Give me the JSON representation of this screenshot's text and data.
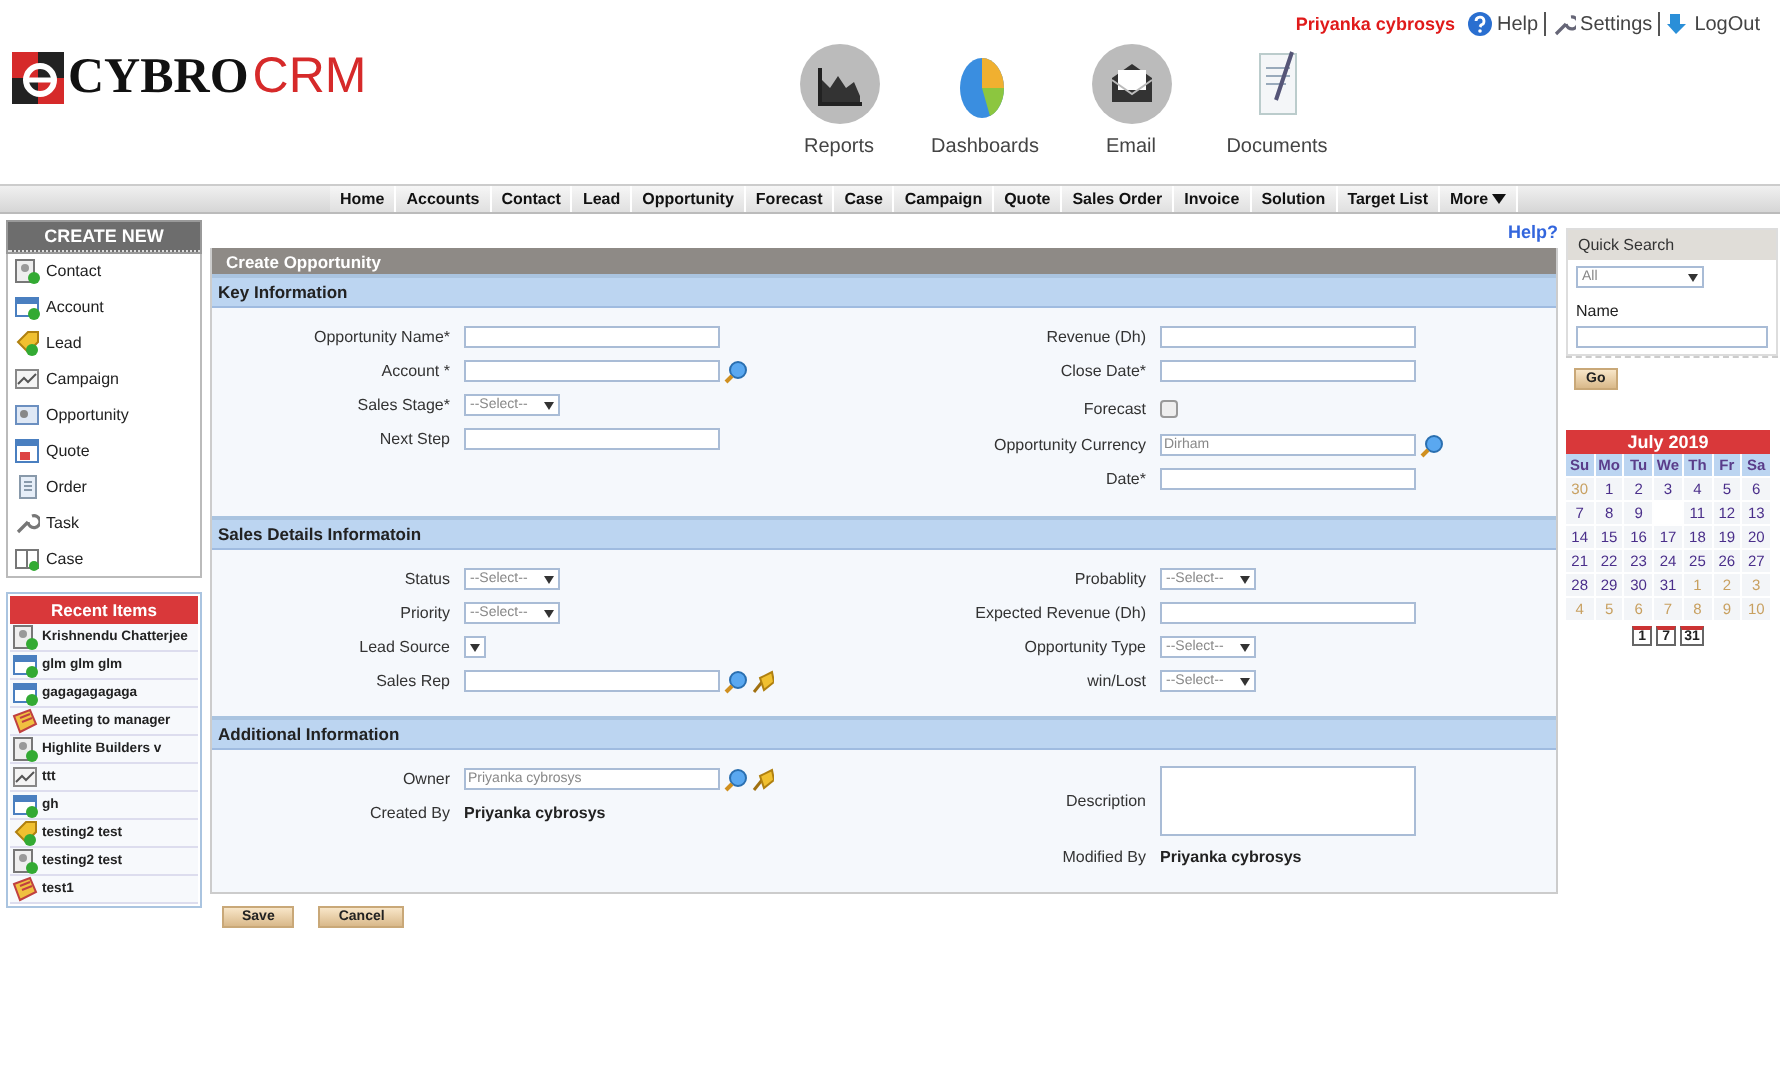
{
  "header": {
    "logo": {
      "part_1": "CYBRO",
      "part_2": "CRM"
    },
    "user": "Priyanka cybrosys",
    "links": [
      {
        "kind": "help",
        "label": "Help"
      },
      {
        "kind": "settings",
        "label": "Settings"
      },
      {
        "kind": "logout",
        "label": "LogOut"
      }
    ],
    "apps": [
      {
        "kind": "reports",
        "label": "Reports"
      },
      {
        "kind": "dashboards",
        "label": "Dashboards"
      },
      {
        "kind": "email",
        "label": "Email"
      },
      {
        "kind": "documents",
        "label": "Documents"
      }
    ]
  },
  "nav": [
    {
      "label": "Home",
      "dropdown": false
    },
    {
      "label": "Accounts",
      "dropdown": false
    },
    {
      "label": "Contact",
      "dropdown": false
    },
    {
      "label": "Lead",
      "dropdown": false
    },
    {
      "label": "Opportunity",
      "dropdown": false
    },
    {
      "label": "Forecast",
      "dropdown": false
    },
    {
      "label": "Case",
      "dropdown": false
    },
    {
      "label": "Campaign",
      "dropdown": false
    },
    {
      "label": "Quote",
      "dropdown": false
    },
    {
      "label": "Sales Order",
      "dropdown": false
    },
    {
      "label": "Invoice",
      "dropdown": false
    },
    {
      "label": "Solution",
      "dropdown": false
    },
    {
      "label": "Target List",
      "dropdown": false
    },
    {
      "label": "More",
      "dropdown": true
    }
  ],
  "create_new": {
    "title": "CREATE NEW",
    "items": [
      {
        "kind": "contact",
        "label": "Contact"
      },
      {
        "kind": "account",
        "label": "Account"
      },
      {
        "kind": "lead",
        "label": "Lead"
      },
      {
        "kind": "campaign",
        "label": "Campaign"
      },
      {
        "kind": "opportunity",
        "label": "Opportunity"
      },
      {
        "kind": "quote",
        "label": "Quote"
      },
      {
        "kind": "order",
        "label": "Order"
      },
      {
        "kind": "task",
        "label": "Task"
      },
      {
        "kind": "case",
        "label": "Case"
      }
    ]
  },
  "recent_items": {
    "title": "Recent Items",
    "items": [
      {
        "kind": "contact",
        "label": "Krishnendu Chatterjee"
      },
      {
        "kind": "account",
        "label": "glm glm glm"
      },
      {
        "kind": "account",
        "label": "gagagagagaga"
      },
      {
        "kind": "meeting",
        "label": "Meeting to manager"
      },
      {
        "kind": "contact",
        "label": "Highlite Builders v"
      },
      {
        "kind": "campaign",
        "label": "ttt"
      },
      {
        "kind": "account",
        "label": "gh"
      },
      {
        "kind": "lead",
        "label": "testing2 test"
      },
      {
        "kind": "contact",
        "label": "testing2 test"
      },
      {
        "kind": "meeting",
        "label": "test1"
      }
    ]
  },
  "help_link": "Help?",
  "form": {
    "title": "Create Opportunity",
    "sections": [
      {
        "title": "Key Information",
        "left": [
          {
            "label": "Opportunity Name*",
            "kind": "text",
            "lookup": false,
            "clear": false
          },
          {
            "label": "Account *",
            "kind": "text",
            "lookup": true,
            "clear": false
          },
          {
            "label": "Sales Stage*",
            "kind": "select",
            "value": "--Select--",
            "lookup": false,
            "clear": false
          },
          {
            "label": "Next Step",
            "kind": "text",
            "lookup": false,
            "clear": false
          }
        ],
        "right": [
          {
            "label": "Revenue (Dh)",
            "kind": "text",
            "lookup": false,
            "clear": false
          },
          {
            "label": "Close Date*",
            "kind": "text",
            "lookup": false,
            "clear": false
          },
          {
            "label": "Forecast",
            "kind": "checkbox",
            "checked": false,
            "lookup": false,
            "clear": false
          },
          {
            "label": "Opportunity Currency",
            "kind": "text",
            "value": "Dirham",
            "lookup": true,
            "clear": false
          },
          {
            "label": "Date*",
            "kind": "text",
            "lookup": false,
            "clear": false
          }
        ]
      },
      {
        "title": "Sales Details Informatoin",
        "left": [
          {
            "label": "Status",
            "kind": "select",
            "value": "--Select--",
            "lookup": false,
            "clear": false
          },
          {
            "label": "Priority",
            "kind": "select",
            "value": "--Select--",
            "lookup": false,
            "clear": false
          },
          {
            "label": "Lead Source",
            "kind": "select",
            "lookup": false,
            "clear": false
          },
          {
            "label": "Sales Rep",
            "kind": "text",
            "lookup": true,
            "clear": true
          }
        ],
        "right": [
          {
            "label": "Probablity",
            "kind": "select",
            "value": "--Select--",
            "lookup": false,
            "clear": false
          },
          {
            "label": "Expected Revenue (Dh)",
            "kind": "text",
            "lookup": false,
            "clear": false
          },
          {
            "label": "Opportunity Type",
            "kind": "select",
            "value": "--Select--",
            "lookup": false,
            "clear": false
          },
          {
            "label": "win/Lost",
            "kind": "select",
            "value": "--Select--",
            "lookup": false,
            "clear": false
          }
        ]
      },
      {
        "title": "Additional Information",
        "left": [
          {
            "label": "Owner",
            "kind": "text",
            "value": "Priyanka cybrosys",
            "lookup": true,
            "clear": true
          },
          {
            "label": "Created By",
            "kind": "static",
            "value": "Priyanka cybrosys",
            "lookup": false,
            "clear": false
          }
        ],
        "right": [
          {
            "label": "Description",
            "kind": "textarea",
            "lookup": false,
            "clear": false
          },
          {
            "label": "Modified By",
            "kind": "static",
            "value": "Priyanka cybrosys",
            "lookup": false,
            "clear": false
          }
        ]
      }
    ],
    "buttons": [
      "Save",
      "Cancel"
    ]
  },
  "quick_search": {
    "title": "Quick Search",
    "select": "All",
    "field_label": "Name",
    "button": "Go"
  },
  "calendar": {
    "title": "July 2019",
    "weekdays": [
      "Su",
      "Mo",
      "Tu",
      "We",
      "Th",
      "Fr",
      "Sa"
    ],
    "days": [
      {
        "kind": "other",
        "label": "30"
      },
      {
        "kind": "day",
        "label": "1"
      },
      {
        "kind": "day",
        "label": "2"
      },
      {
        "kind": "day",
        "label": "3"
      },
      {
        "kind": "day",
        "label": "4"
      },
      {
        "kind": "day",
        "label": "5"
      },
      {
        "kind": "day",
        "label": "6"
      },
      {
        "kind": "day",
        "label": "7"
      },
      {
        "kind": "day",
        "label": "8"
      },
      {
        "kind": "day",
        "label": "9"
      },
      {
        "kind": "blank"
      },
      {
        "kind": "day",
        "label": "11"
      },
      {
        "kind": "day",
        "label": "12"
      },
      {
        "kind": "day",
        "label": "13"
      },
      {
        "kind": "day",
        "label": "14"
      },
      {
        "kind": "day",
        "label": "15"
      },
      {
        "kind": "day",
        "label": "16"
      },
      {
        "kind": "day",
        "label": "17"
      },
      {
        "kind": "day",
        "label": "18"
      },
      {
        "kind": "day",
        "label": "19"
      },
      {
        "kind": "day",
        "label": "20"
      },
      {
        "kind": "day",
        "label": "21"
      },
      {
        "kind": "day",
        "label": "22"
      },
      {
        "kind": "day",
        "label": "23"
      },
      {
        "kind": "day",
        "label": "24"
      },
      {
        "kind": "day",
        "label": "25"
      },
      {
        "kind": "day",
        "label": "26"
      },
      {
        "kind": "day",
        "label": "27"
      },
      {
        "kind": "day",
        "label": "28"
      },
      {
        "kind": "day",
        "label": "29"
      },
      {
        "kind": "day",
        "label": "30"
      },
      {
        "kind": "day",
        "label": "31"
      },
      {
        "kind": "other",
        "label": "1"
      },
      {
        "kind": "other",
        "label": "2"
      },
      {
        "kind": "other",
        "label": "3"
      },
      {
        "kind": "other",
        "label": "4"
      },
      {
        "kind": "other",
        "label": "5"
      },
      {
        "kind": "other",
        "label": "6"
      },
      {
        "kind": "other",
        "label": "7"
      },
      {
        "kind": "other",
        "label": "8"
      },
      {
        "kind": "other",
        "label": "9"
      },
      {
        "kind": "other",
        "label": "10"
      }
    ],
    "views": [
      "1",
      "7",
      "31"
    ]
  }
}
